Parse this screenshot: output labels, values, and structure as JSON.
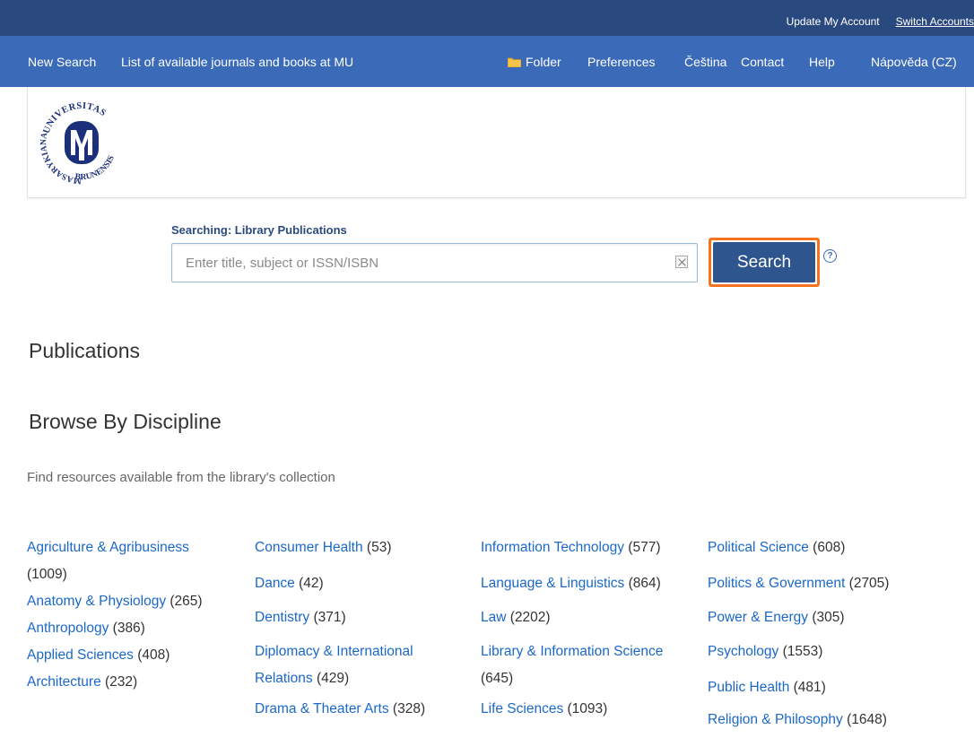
{
  "top_bar": {
    "update_account": "Update My Account",
    "switch_accounts": "Switch Accounts"
  },
  "nav": {
    "new_search": "New Search",
    "journals_link": "List of available journals and books at MU",
    "folder": "Folder",
    "preferences": "Preferences",
    "language": "Čeština",
    "contact": "Contact",
    "help": "Help",
    "help_cz": "Nápověda (CZ)"
  },
  "logo": {
    "text_top": "UNIVERSITAS",
    "text_left": "MASARYKIANA",
    "text_bottom": "BRUNENSIS",
    "monogram": "M",
    "color": "#1c2f7a"
  },
  "search": {
    "label": "Searching: Library Publications",
    "placeholder": "Enter title, subject or ISSN/ISBN",
    "value": "",
    "button_label": "Search",
    "help_glyph": "?"
  },
  "headings": {
    "publications": "Publications",
    "browse": "Browse By Discipline",
    "intro": "Find resources available from the library's collection"
  },
  "disciplines": {
    "col1": [
      {
        "name": "Agriculture & Agribusiness",
        "count": ""
      },
      {
        "name": "",
        "count": "(1009)"
      },
      {
        "name": "Anatomy & Physiology",
        "count": "(265)"
      },
      {
        "name": "Anthropology",
        "count": "(386)"
      },
      {
        "name": "Applied Sciences",
        "count": "(408)"
      },
      {
        "name": "Architecture",
        "count": "(232)"
      }
    ],
    "col2": [
      {
        "name": "Consumer Health",
        "count": "(53)"
      },
      {
        "name": "Dance",
        "count": "(42)"
      },
      {
        "name": "Dentistry",
        "count": "(371)"
      },
      {
        "name": "Diplomacy & International",
        "count": ""
      },
      {
        "name": "Relations",
        "count": "(429)"
      },
      {
        "name": "Drama & Theater Arts",
        "count": "(328)"
      }
    ],
    "col3": [
      {
        "name": "Information Technology",
        "count": "(577)"
      },
      {
        "name": "Language & Linguistics",
        "count": "(864)"
      },
      {
        "name": "Law",
        "count": "(2202)"
      },
      {
        "name": "Library & Information Science",
        "count": ""
      },
      {
        "name": "",
        "count": "(645)"
      },
      {
        "name": "Life Sciences",
        "count": "(1093)"
      }
    ],
    "col4": [
      {
        "name": "Political Science",
        "count": "(608)"
      },
      {
        "name": "Politics & Government",
        "count": "(2705)"
      },
      {
        "name": "Power & Energy",
        "count": "(305)"
      },
      {
        "name": "Psychology",
        "count": "(1553)"
      },
      {
        "name": "Public Health",
        "count": "(481)"
      },
      {
        "name": "Religion & Philosophy",
        "count": "(1648)"
      }
    ]
  },
  "colors": {
    "top_bar": "#2a4a7f",
    "nav_bar": "#3a6ab8",
    "link": "#1b68c9",
    "search_button": "#2f558f",
    "focus_ring": "#f5731f"
  }
}
